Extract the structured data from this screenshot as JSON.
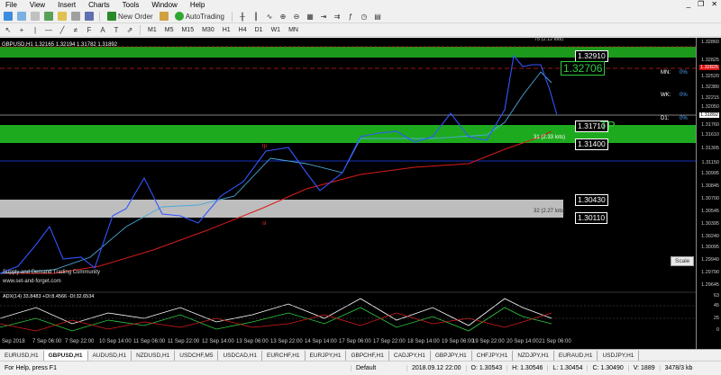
{
  "menu": [
    "File",
    "View",
    "Insert",
    "Charts",
    "Tools",
    "Window",
    "Help"
  ],
  "toolbar": {
    "new_order": "New Order",
    "autotrading": "AutoTrading"
  },
  "timeframes": [
    "M1",
    "M5",
    "M15",
    "M30",
    "H1",
    "H4",
    "D1",
    "W1",
    "MN"
  ],
  "chart": {
    "title": "GBPUSD,H1  1.32165 1.32194 1.31782 1.31892",
    "top_line_label": "75 (2.12 lots)",
    "yticks": [
      "1.32860",
      "1.32825",
      "1.32520",
      "1.32380",
      "1.32215",
      "1.32050",
      "1.31892",
      "1.31760",
      "1.31610",
      "1.31305",
      "1.31150",
      "1.30995",
      "1.30845",
      "1.30700",
      "1.30545",
      "1.30395",
      "1.30240",
      "1.30095",
      "1.29940",
      "1.29790",
      "1.29645",
      "1.29490"
    ],
    "price_boxes": {
      "p1": "1.32910",
      "p2": "1.31710",
      "p3": "1.31400",
      "p4": "1.30430",
      "p5": "1.30110"
    },
    "current_price_big": "1.32706",
    "tp_label": "TP",
    "lots_31": "31 (2.33 lots)",
    "lots_32": "32 (2.27 lots)",
    "tp_small": "tp",
    "sl_small": "sl",
    "mn": "MN:",
    "mn_val": "0%",
    "wk": "WK:",
    "wk_val": "0%",
    "d1": "D1:",
    "d1_val": "0%",
    "watermark1": "Supply and Demand Trading Community",
    "watermark2": "www.set-and-forget.com",
    "scale_btn": "Scale",
    "adx_label": "ADX(14) 33.8483 +DI:8.4566 -DI:32.6534",
    "adx_ticks": [
      "63",
      "45",
      "25",
      "0"
    ],
    "xticks": [
      "Sep 2018",
      "7 Sep 06:00",
      "7 Sep 22:00",
      "10 Sep 14:00",
      "11 Sep 06:00",
      "11 Sep 22:00",
      "12 Sep 14:00",
      "13 Sep 06:00",
      "13 Sep 22:00",
      "14 Sep 14:00",
      "17 Sep 06:00",
      "17 Sep 22:00",
      "18 Sep 14:00",
      "19 Sep 06:00",
      "19 Sep 22:00",
      "20 Sep 14:00",
      "21 Sep 06:00"
    ]
  },
  "tabs": [
    "EURUSD,H1",
    "GBPUSD,H1",
    "AUDUSD,H1",
    "NZDUSD,H1",
    "USDCHF,M5",
    "USDCAD,H1",
    "EURCHF,H1",
    "EURJPY,H1",
    "GBPCHF,H1",
    "CADJPY,H1",
    "GBPJPY,H1",
    "CHFJPY,H1",
    "NZDJPY,H1",
    "EURAUD,H1",
    "USDJPY,H1"
  ],
  "active_tab": "GBPUSD,H1",
  "status": {
    "help": "For Help, press F1",
    "profile": "Default",
    "time": "2018.09.12 22:00",
    "open": "O: 1.30543",
    "high": "H: 1.30546",
    "low": "L: 1.30454",
    "close": "C: 1.30490",
    "vol": "V: 1889",
    "mem": "3478/3 kb"
  }
}
